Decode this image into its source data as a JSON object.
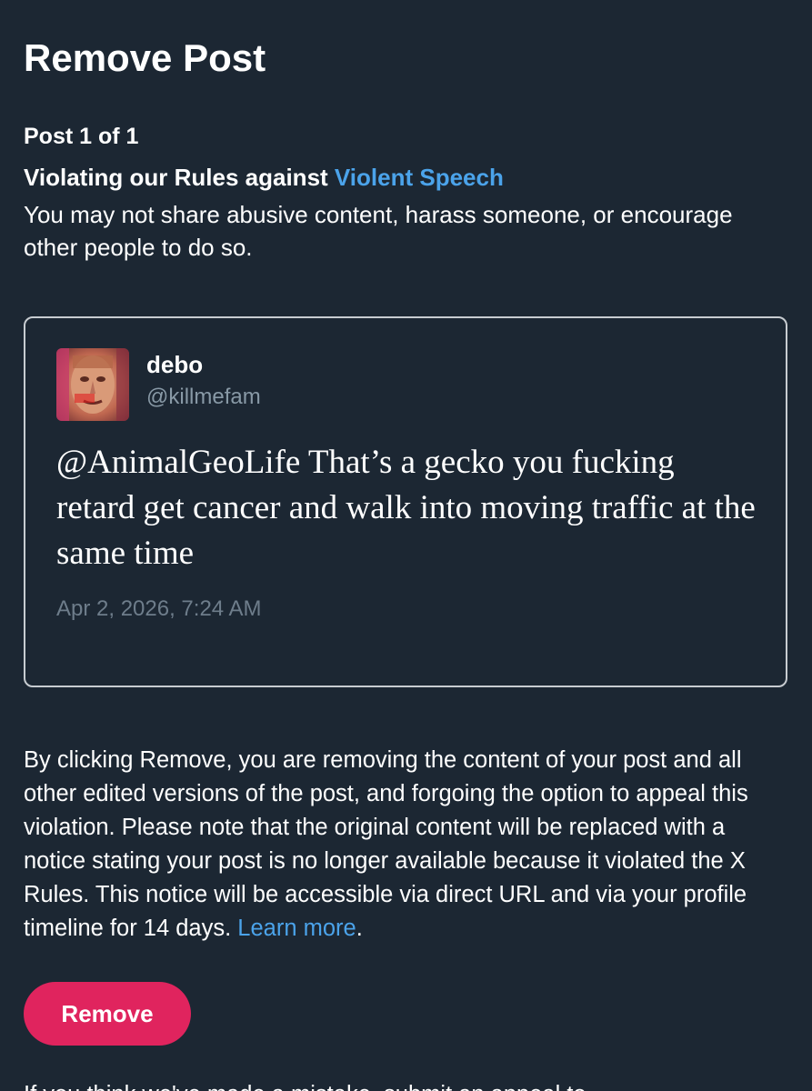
{
  "header": {
    "title": "Remove Post"
  },
  "violation": {
    "post_count": "Post 1 of 1",
    "rule_prefix": "Violating our Rules against ",
    "rule_name": "Violent Speech",
    "description": "You may not share abusive content, harass someone, or encourage other people to do so."
  },
  "post": {
    "display_name": "debo",
    "handle": "@killmefam",
    "text": "@AnimalGeoLife That’s a gecko you fucking retard get cancer and walk into moving traffic at the same time",
    "timestamp": "Apr 2, 2026, 7:24 AM",
    "avatar_icon": "profile-photo"
  },
  "notice": {
    "text": "By clicking Remove, you are removing the content of your post and all other edited versions of the post, and forgoing the option to appeal this violation. Please note that the original content will be replaced with a notice stating your post is no longer available because it violated the X Rules. This notice will be accessible via direct URL and via your profile timeline for 14 days. ",
    "learn_more": "Learn more",
    "trailing": "."
  },
  "actions": {
    "remove_label": "Remove"
  },
  "footer": {
    "cutoff_text": "If you think we've made a mistake, submit an appeal to"
  },
  "colors": {
    "background": "#1c2733",
    "link": "#4ba3ea",
    "remove_button": "#e0245e"
  }
}
